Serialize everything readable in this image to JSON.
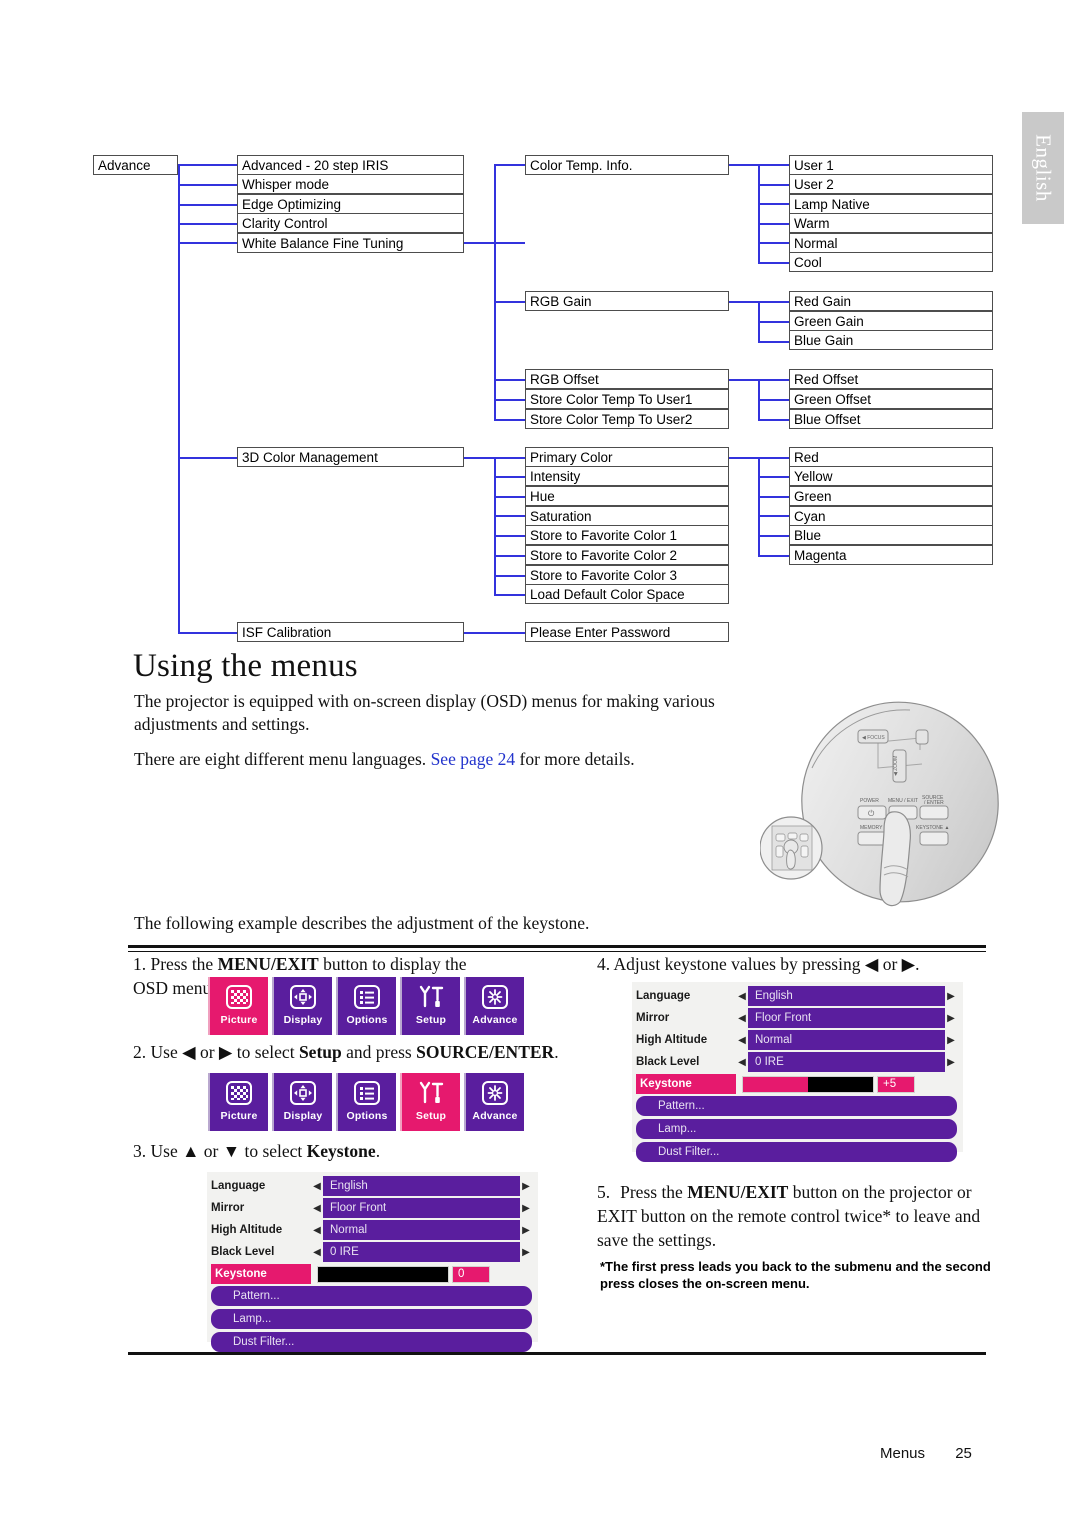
{
  "side_tab": {
    "label": "English"
  },
  "tree": {
    "col1": [
      {
        "label": "Advance"
      }
    ],
    "col2_group1": [
      {
        "label": "Advanced - 20 step IRIS"
      },
      {
        "label": "Whisper mode"
      },
      {
        "label": "Edge Optimizing"
      },
      {
        "label": "Clarity Control"
      },
      {
        "label": "White Balance Fine Tuning"
      }
    ],
    "col2_group2": [
      {
        "label": "3D Color Management"
      }
    ],
    "col2_group3": [
      {
        "label": "ISF Calibration"
      }
    ],
    "col3_group1": [
      {
        "label": "Color Temp. Info."
      }
    ],
    "col3_group2": [
      {
        "label": "RGB Gain"
      }
    ],
    "col3_group3": [
      {
        "label": "RGB Offset"
      },
      {
        "label": "Store Color Temp To User1"
      },
      {
        "label": "Store Color Temp To User2"
      }
    ],
    "col3_group4": [
      {
        "label": "Primary Color"
      },
      {
        "label": "Intensity"
      },
      {
        "label": "Hue"
      },
      {
        "label": "Saturation"
      },
      {
        "label": "Store to Favorite Color 1"
      },
      {
        "label": "Store to Favorite Color 2"
      },
      {
        "label": "Store to Favorite Color 3"
      },
      {
        "label": "Load Default Color Space"
      }
    ],
    "col3_group5": [
      {
        "label": "Please Enter Password"
      }
    ],
    "col4_group1": [
      {
        "label": "User 1"
      },
      {
        "label": "User 2"
      },
      {
        "label": "Lamp Native"
      },
      {
        "label": "Warm"
      },
      {
        "label": "Normal"
      },
      {
        "label": "Cool"
      }
    ],
    "col4_group2": [
      {
        "label": "Red Gain"
      },
      {
        "label": "Green Gain"
      },
      {
        "label": "Blue Gain"
      }
    ],
    "col4_group3": [
      {
        "label": "Red Offset"
      },
      {
        "label": "Green Offset"
      },
      {
        "label": "Blue Offset"
      }
    ],
    "col4_group4": [
      {
        "label": "Red"
      },
      {
        "label": "Yellow"
      },
      {
        "label": "Green"
      },
      {
        "label": "Cyan"
      },
      {
        "label": "Blue"
      },
      {
        "label": "Magenta"
      }
    ]
  },
  "heading": "Using the menus",
  "intro": {
    "para1": "The projector is equipped with on-screen display (OSD) menus for making various adjustments and settings.",
    "para2_before": "There are eight different menu languages. ",
    "para2_link": "See page 24",
    "para2_after": " for more details."
  },
  "example_intro": "The following example describes the adjustment of the keystone.",
  "steps": {
    "s1_num": "1.",
    "s1_a": "Press the ",
    "s1_bold": "MENU/EXIT",
    "s1_b": " button to display the OSD menu.",
    "s4_num": "4.",
    "s4_a": "Adjust keystone values by pressing ",
    "s4_left": "◀",
    "s4_or": " or ",
    "s4_right": "▶",
    "s4_b": ".",
    "s2_num": "2.",
    "s2_a": "Use ",
    "s2_left": "◀",
    "s2_or": " or ",
    "s2_right": "▶",
    "s2_b": " to select ",
    "s2_bold1": "Setup",
    "s2_c": " and press ",
    "s2_bold2": "SOURCE/ENTER",
    "s2_d": ".",
    "s3_num": "3.",
    "s3_a": "Use ",
    "s3_up": "▲",
    "s3_or": " or ",
    "s3_down": "▼",
    "s3_b": " to select ",
    "s3_bold": "Keystone",
    "s3_c": ".",
    "s5_num": "5.",
    "s5_a": "Press the ",
    "s5_bold": "MENU/EXIT",
    "s5_b": " button on the projector or EXIT button on the remote control twice* to leave and save the settings.",
    "s5_note": "*The first press leads you back to the submenu and the second press closes the on-screen menu."
  },
  "iconbar_top": {
    "items": [
      {
        "caption": "Picture",
        "icon": "checkerboard-icon",
        "selected": true
      },
      {
        "caption": "Display",
        "icon": "four-arrows-icon",
        "selected": false
      },
      {
        "caption": "Options",
        "icon": "list-icon",
        "selected": false
      },
      {
        "caption": "Setup",
        "icon": "tools-icon",
        "selected": false
      },
      {
        "caption": "Advance",
        "icon": "starburst-icon",
        "selected": false
      }
    ]
  },
  "iconbar_bottom": {
    "items": [
      {
        "caption": "Picture",
        "icon": "checkerboard-icon",
        "selected": false
      },
      {
        "caption": "Display",
        "icon": "four-arrows-icon",
        "selected": false
      },
      {
        "caption": "Options",
        "icon": "list-icon",
        "selected": false
      },
      {
        "caption": "Setup",
        "icon": "tools-icon",
        "selected": true
      },
      {
        "caption": "Advance",
        "icon": "starburst-icon",
        "selected": false
      }
    ]
  },
  "osd_right": {
    "rows": [
      {
        "label": "Language",
        "value": "English"
      },
      {
        "label": "Mirror",
        "value": "Floor Front"
      },
      {
        "label": "High Altitude",
        "value": "Normal"
      },
      {
        "label": "Black Level",
        "value": "0 IRE"
      }
    ],
    "keystone_label": "Keystone",
    "keystone_value": "+5",
    "keystone_fill_pct": 50,
    "submenus": [
      "Pattern...",
      "Lamp...",
      "Dust Filter..."
    ],
    "arrow_left": "◀",
    "arrow_right": "▶"
  },
  "osd_bottom": {
    "rows": [
      {
        "label": "Language",
        "value": "English"
      },
      {
        "label": "Mirror",
        "value": "Floor Front"
      },
      {
        "label": "High Altitude",
        "value": "Normal"
      },
      {
        "label": "Black Level",
        "value": "0 IRE"
      }
    ],
    "keystone_label": "Keystone",
    "keystone_value": "0",
    "keystone_fill_pct": 100,
    "submenus": [
      "Pattern...",
      "Lamp...",
      "Dust Filter..."
    ],
    "arrow_left": "◀",
    "arrow_right": "▶"
  },
  "footer": {
    "section": "Menus",
    "page": "25"
  },
  "colors": {
    "accent_pink": "#e6196e",
    "menu_purple": "#5a1e9e",
    "link_blue": "#2233cc",
    "tree_line": "#3333dd",
    "tab_gray": "#c9c9c9"
  }
}
